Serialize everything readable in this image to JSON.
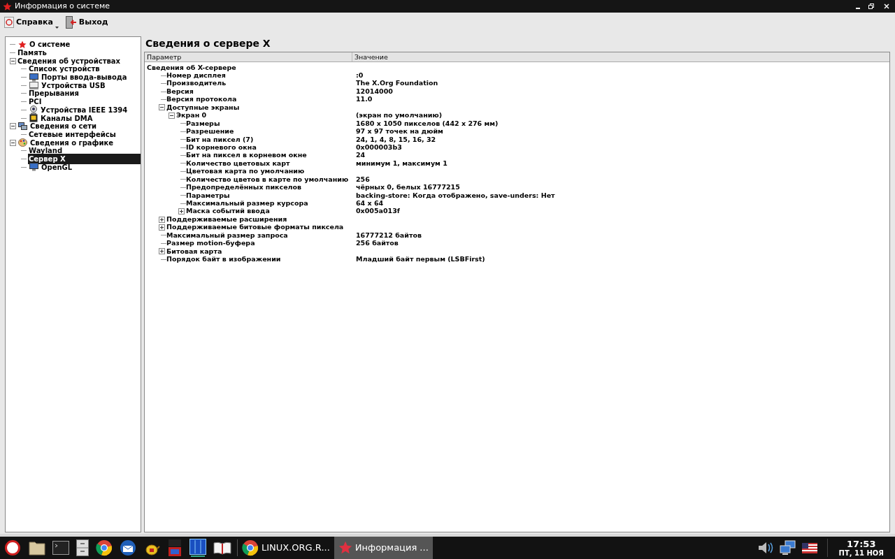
{
  "window": {
    "title": "Информация о системе"
  },
  "toolbar": [
    {
      "label": "Справка",
      "kind": "help",
      "dropdown": true
    },
    {
      "label": "Выход",
      "kind": "exit",
      "dropdown": false
    }
  ],
  "sidebar": {
    "items": [
      {
        "label": "О системе",
        "kind": "star",
        "selected": false
      },
      {
        "label": "Память",
        "selected": false
      },
      {
        "label": "Сведения об устройствах",
        "expanded": true,
        "selected": false,
        "children": [
          {
            "label": "Список устройств",
            "selected": false
          },
          {
            "label": "Порты ввода-вывода",
            "kind": "monitor",
            "selected": false
          },
          {
            "label": "Устройства USB",
            "kind": "device",
            "selected": false
          },
          {
            "label": "Прерывания",
            "selected": false
          },
          {
            "label": "PCI",
            "selected": false
          },
          {
            "label": "Устройства IEEE 1394",
            "kind": "camera",
            "selected": false
          },
          {
            "label": "Каналы DMA",
            "kind": "chip",
            "selected": false
          }
        ]
      },
      {
        "label": "Сведения о сети",
        "kind": "network",
        "expanded": true,
        "selected": false,
        "children": [
          {
            "label": "Сетевые интерфейсы",
            "selected": false
          }
        ]
      },
      {
        "label": "Сведения о графике",
        "kind": "palette",
        "expanded": true,
        "selected": false,
        "children": [
          {
            "label": "Wayland",
            "selected": false
          },
          {
            "label": "Сервер X",
            "selected": true
          },
          {
            "label": "OpenGL",
            "kind": "monitor",
            "selected": false
          }
        ]
      }
    ]
  },
  "content": {
    "title": "Сведения о сервере X",
    "table": {
      "columns": [
        "Параметр",
        "Значение"
      ],
      "rows": [
        {
          "param": "Сведения об X-сервере",
          "children": [
            {
              "param": "Номер дисплея",
              "value": ":0"
            },
            {
              "param": "Производитель",
              "value": "The X.Org Foundation"
            },
            {
              "param": "Версия",
              "value": "12014000"
            },
            {
              "param": "Версия протокола",
              "value": "11.0"
            },
            {
              "param": "Доступные экраны",
              "expanded": true,
              "children": [
                {
                  "param": "Экран 0",
                  "value": "(экран по умолчанию)",
                  "expanded": true,
                  "children": [
                    {
                      "param": "Размеры",
                      "value": "1680 x 1050 пикселов (442 x 276 мм)"
                    },
                    {
                      "param": "Разрешение",
                      "value": "97 x 97 точек на дюйм"
                    },
                    {
                      "param": "Бит на пиксел (7)",
                      "value": "24, 1, 4, 8, 15, 16, 32"
                    },
                    {
                      "param": "ID корневого окна",
                      "value": "0x000003b3"
                    },
                    {
                      "param": "Бит на пиксел в корневом окне",
                      "value": "24"
                    },
                    {
                      "param": "Количество цветовых карт",
                      "value": "минимум 1, максимум 1"
                    },
                    {
                      "param": "Цветовая карта по умолчанию"
                    },
                    {
                      "param": "Количество цветов в карте по умолчанию",
                      "value": "256"
                    },
                    {
                      "param": "Предопределённых пикселов",
                      "value": "чёрных 0, белых 16777215"
                    },
                    {
                      "param": "Параметры",
                      "value": "backing-store: Когда отображено, save-unders: Нет"
                    },
                    {
                      "param": "Максимальный размер курсора",
                      "value": "64 x 64"
                    },
                    {
                      "param": "Маска событий ввода",
                      "value": "0x005a013f",
                      "expanded": false
                    }
                  ]
                }
              ]
            },
            {
              "param": "Поддерживаемые расширения",
              "expanded": false
            },
            {
              "param": "Поддерживаемые битовые форматы пиксела",
              "expanded": false
            },
            {
              "param": "Максимальный размер запроса",
              "value": "16777212 байтов"
            },
            {
              "param": "Размер motion-буфера",
              "value": "256 байтов"
            },
            {
              "param": "Битовая карта",
              "expanded": false
            },
            {
              "param": "Порядок байт в изображении",
              "value": "Младший байт первым (LSBFirst)"
            }
          ]
        }
      ]
    }
  },
  "taskbar": {
    "launchers": [
      {
        "kind": "ring"
      },
      {
        "kind": "folder"
      },
      {
        "kind": "terminal"
      },
      {
        "kind": "cabinet"
      },
      {
        "kind": "browser"
      },
      {
        "kind": "mail"
      },
      {
        "kind": "teapot"
      },
      {
        "kind": "box"
      },
      {
        "kind": "server"
      },
      {
        "kind": "book"
      }
    ],
    "tasks": [
      {
        "label": "LINUX.ORG.R...",
        "kind": "browser",
        "selected": false
      },
      {
        "label": "Информация ...",
        "kind": "star",
        "selected": true
      }
    ],
    "clock": {
      "time": "17:53",
      "date": "ПТ, 11 НОЯ"
    }
  }
}
